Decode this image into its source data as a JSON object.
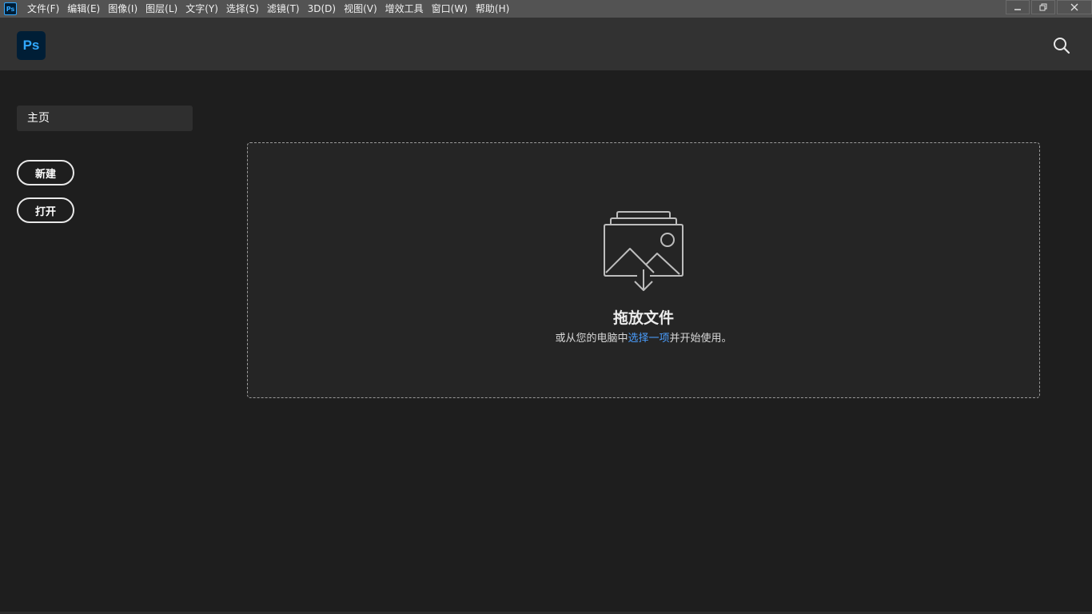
{
  "menubar": {
    "app_icon": "Ps",
    "items": [
      "文件(F)",
      "编辑(E)",
      "图像(I)",
      "图层(L)",
      "文字(Y)",
      "选择(S)",
      "滤镜(T)",
      "3D(D)",
      "视图(V)",
      "增效工具",
      "窗口(W)",
      "帮助(H)"
    ],
    "controls": {
      "minimize": "minimize-icon",
      "restore": "restore-icon",
      "close": "close-icon"
    }
  },
  "header": {
    "logo": "Ps",
    "search_icon": "search-icon"
  },
  "sidebar": {
    "home_label": "主页",
    "new_label": "新建",
    "open_label": "打开"
  },
  "dropzone": {
    "icon": "image-import-icon",
    "title": "拖放文件",
    "sub_before": "或从您的电脑中",
    "sub_link": "选择一项",
    "sub_after": "并开始使用。"
  },
  "colors": {
    "accent": "#31a8ff",
    "link": "#4a9eff",
    "background": "#1e1e1e",
    "header": "#323232"
  }
}
